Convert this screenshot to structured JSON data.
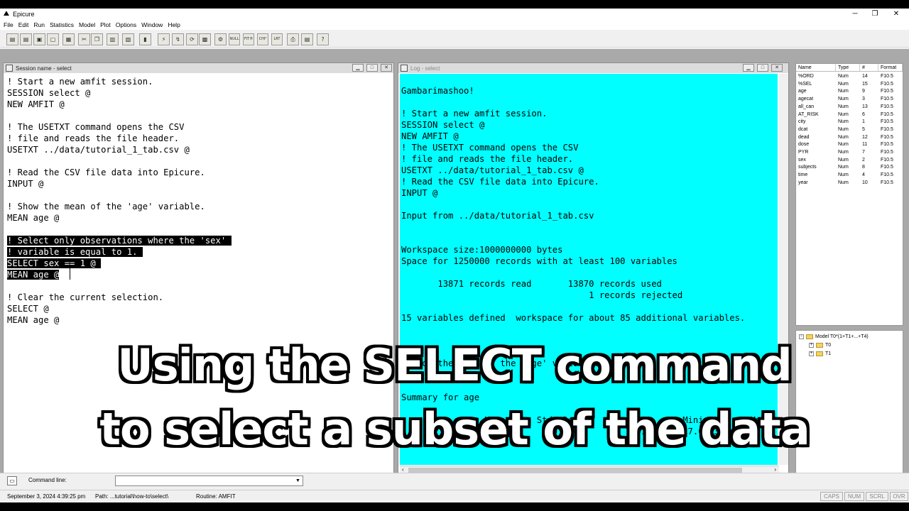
{
  "app": {
    "title": "Epicure"
  },
  "menu": [
    "File",
    "Edit",
    "Run",
    "Statistics",
    "Model",
    "Plot",
    "Options",
    "Window",
    "Help"
  ],
  "toolbar": {
    "buttons": [
      {
        "name": "open-icon",
        "glyph": "▤"
      },
      {
        "name": "open-alt-icon",
        "glyph": "▤"
      },
      {
        "name": "save-icon",
        "glyph": "▣"
      },
      {
        "name": "new-icon",
        "glyph": "▢"
      },
      {
        "name": "print-preview-icon",
        "glyph": "▦"
      },
      {
        "name": "cut-icon",
        "glyph": "✂"
      },
      {
        "name": "copy-icon",
        "glyph": "❐"
      },
      {
        "name": "paste-icon",
        "glyph": "▥"
      },
      {
        "name": "find-icon",
        "glyph": "▧"
      },
      {
        "name": "chart-icon",
        "glyph": "▮"
      },
      {
        "name": "run-icon",
        "glyph": "⚡"
      },
      {
        "name": "step-icon",
        "glyph": "↯"
      },
      {
        "name": "refresh-icon",
        "glyph": "⟳"
      },
      {
        "name": "data-icon",
        "glyph": "▩"
      },
      {
        "name": "model-icon",
        "glyph": "⚙"
      },
      {
        "name": "null-button",
        "glyph": "NULL",
        "txt": true
      },
      {
        "name": "fit-button",
        "glyph": "FIT®",
        "txt": true
      },
      {
        "name": "chi-button",
        "glyph": "CHI²",
        "txt": true
      },
      {
        "name": "lrt-button",
        "glyph": "LRT",
        "txt": true
      },
      {
        "name": "print-icon",
        "glyph": "⎙"
      },
      {
        "name": "table-icon",
        "glyph": "▤"
      },
      {
        "name": "help-icon",
        "glyph": "?"
      }
    ]
  },
  "session_window": {
    "title": "Session name - select",
    "lines": [
      {
        "text": "! Start a new amfit session.",
        "hl": false
      },
      {
        "text": "SESSION select @",
        "hl": false
      },
      {
        "text": "NEW AMFIT @",
        "hl": false
      },
      {
        "text": "",
        "hl": false
      },
      {
        "text": "! The USETXT command opens the CSV",
        "hl": false
      },
      {
        "text": "! file and reads the file header.",
        "hl": false
      },
      {
        "text": "USETXT ../data/tutorial_1_tab.csv @",
        "hl": false
      },
      {
        "text": "",
        "hl": false
      },
      {
        "text": "! Read the CSV file data into Epicure.",
        "hl": false
      },
      {
        "text": "INPUT @",
        "hl": false
      },
      {
        "text": "",
        "hl": false
      },
      {
        "text": "! Show the mean of the 'age' variable.",
        "hl": false
      },
      {
        "text": "MEAN age @",
        "hl": false
      },
      {
        "text": "",
        "hl": false
      },
      {
        "text": "! Select only observations where the 'sex' ",
        "hl": true
      },
      {
        "text": "! variable is equal to 1. ",
        "hl": true
      },
      {
        "text": "SELECT sex == 1 @ ",
        "hl": true
      },
      {
        "text": "MEAN age @",
        "hl": true
      },
      {
        "text": "",
        "hl": false
      },
      {
        "text": "! Clear the current selection.",
        "hl": false
      },
      {
        "text": "SELECT @",
        "hl": false
      },
      {
        "text": "MEAN age @",
        "hl": false
      }
    ]
  },
  "log_window": {
    "title": "Log - select",
    "lines": [
      "",
      "Gambarimashoo!",
      "",
      "! Start a new amfit session.",
      "SESSION select @",
      "NEW AMFIT @",
      "! The USETXT command opens the CSV",
      "! file and reads the file header.",
      "USETXT ../data/tutorial_1_tab.csv @",
      "! Read the CSV file data into Epicure.",
      "INPUT @",
      "",
      "Input from ../data/tutorial_1_tab.csv",
      "",
      "",
      "Workspace size:1000000000 bytes",
      "Space for 1250000 records with at least 100 variables",
      "",
      "       13871 records read       13870 records used",
      "                                    1 records rejected",
      "",
      "15 variables defined  workspace for about 85 additional variables.",
      "",
      "",
      "",
      "! Show the mean of the 'age' variable.",
      "MEAN age @",
      "",
      "Summary for age",
      "",
      "                Mean      Std. Dev.        Count      Minimum      Maximum",
      "             57.8964        20.76          13870      17.0773"
    ]
  },
  "variables": {
    "headers": [
      "Name",
      "Type",
      "#",
      "Format"
    ],
    "rows": [
      [
        "%ORD",
        "Num",
        "14",
        "F10.5"
      ],
      [
        "%SEL",
        "Num",
        "15",
        "F10.5"
      ],
      [
        "age",
        "Num",
        "9",
        "F10.5"
      ],
      [
        "agecat",
        "Num",
        "3",
        "F10.5"
      ],
      [
        "all_can",
        "Num",
        "13",
        "F10.5"
      ],
      [
        "AT_RISK",
        "Num",
        "6",
        "F10.5"
      ],
      [
        "city",
        "Num",
        "1",
        "F10.5"
      ],
      [
        "dcat",
        "Num",
        "5",
        "F10.5"
      ],
      [
        "dead",
        "Num",
        "12",
        "F10.5"
      ],
      [
        "dose",
        "Num",
        "11",
        "F10.5"
      ],
      [
        "PYR",
        "Num",
        "7",
        "F10.5"
      ],
      [
        "sex",
        "Num",
        "2",
        "F10.5"
      ],
      [
        "subjects",
        "Num",
        "8",
        "F10.5"
      ],
      [
        "time",
        "Num",
        "4",
        "F10.5"
      ],
      [
        "year",
        "Num",
        "10",
        "F10.5"
      ]
    ]
  },
  "model_tree": {
    "root": "Model T0*(1+T1+...+T4)",
    "children": [
      "T0",
      "T1"
    ]
  },
  "command": {
    "label": "Command line:",
    "value": ""
  },
  "status": {
    "datetime": "September 3, 2024 4:39:25 pm",
    "path": "Path: ...tutorial\\how-to\\select\\",
    "routine": "Routine: AMFIT",
    "keys": [
      "CAPS",
      "NUM",
      "SCRL",
      "OVR"
    ]
  },
  "caption": {
    "line1": "Using the SELECT command",
    "line2": "to select a subset of the data"
  }
}
